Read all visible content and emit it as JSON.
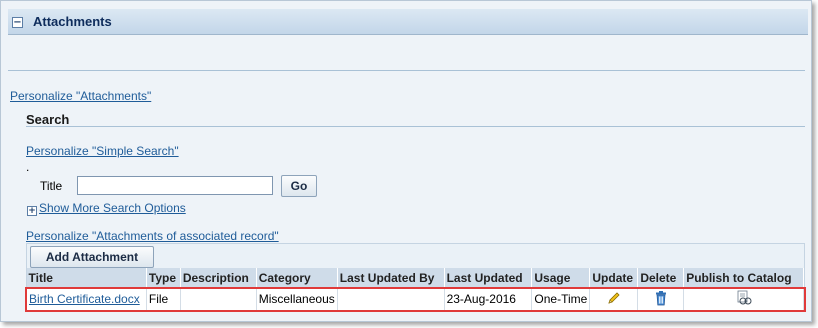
{
  "section": {
    "title": "Attachments",
    "collapse_symbol": "−"
  },
  "personalize_attachments": "Personalize \"Attachments\"",
  "search": {
    "title": "Search",
    "personalize": "Personalize \"Simple Search\"",
    "dot": ".",
    "field_label": "Title",
    "field_value": "",
    "go_label": "Go",
    "more_options_symbol": "+",
    "more_options": "Show More Search Options"
  },
  "results": {
    "personalize": "Personalize \"Attachments of associated record\"",
    "add_label": "Add Attachment",
    "columns": [
      "Title",
      "Type",
      "Description",
      "Category",
      "Last Updated By",
      "Last Updated",
      "Usage",
      "Update",
      "Delete",
      "Publish to Catalog"
    ],
    "rows": [
      {
        "title": "Birth Certificate.docx",
        "type": "File",
        "description": "",
        "category": "Miscellaneous",
        "last_updated_by": "",
        "last_updated": "23-Aug-2016",
        "usage": "One-Time",
        "update_icon": "pencil-icon",
        "delete_icon": "trash-icon",
        "publish_icon": "publish-catalog-icon"
      }
    ]
  },
  "colors": {
    "header_bg": "#c8d9ea",
    "link": "#1f5c99",
    "highlight": "#e03a3a"
  }
}
